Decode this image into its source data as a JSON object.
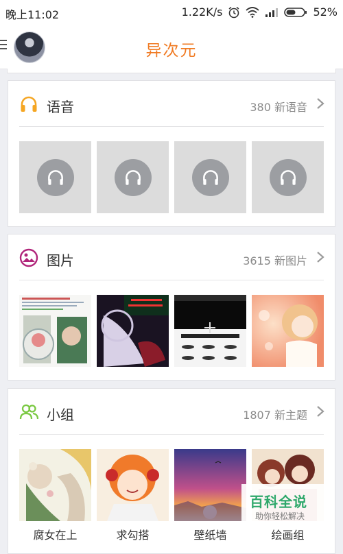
{
  "status_bar": {
    "time": "晚上11:02",
    "network_speed": "1.22K/s",
    "battery": "52%"
  },
  "header": {
    "title": "异次元"
  },
  "sections": {
    "voice": {
      "title": "语音",
      "count": "380 新语音",
      "icon_color": "#f5a623"
    },
    "images": {
      "title": "图片",
      "count": "3615 新图片",
      "icon_color": "#b0247a"
    },
    "groups": {
      "title": "小组",
      "count": "1807 新主题",
      "icon_color": "#7bc943",
      "items": [
        "腐女在上",
        "求勾搭",
        "壁纸墙",
        "绘画组"
      ]
    }
  },
  "watermark": {
    "main": "百科全说",
    "sub": "助你轻松解决"
  },
  "colors": {
    "accent": "#f07a22",
    "background": "#eeeff3"
  }
}
